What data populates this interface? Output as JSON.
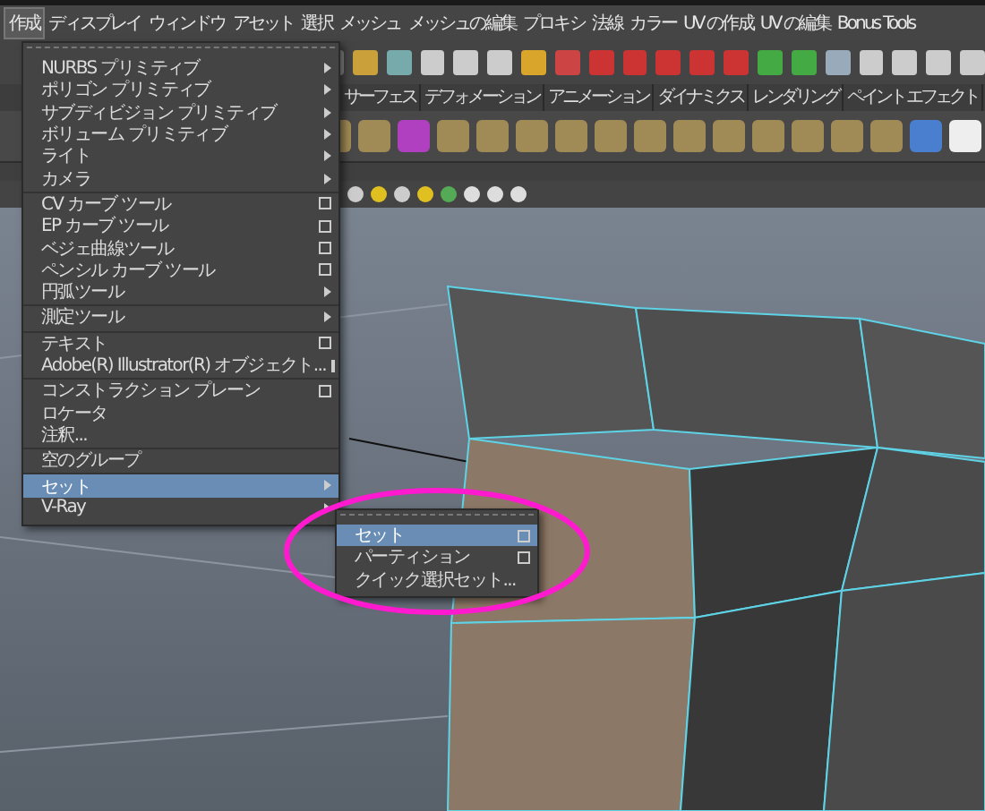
{
  "menubar": [
    {
      "label": "作成",
      "selected": true
    },
    {
      "label": "ディスプレイ",
      "selected": false
    },
    {
      "label": "ウィンドウ",
      "selected": false
    },
    {
      "label": "アセット",
      "selected": false
    },
    {
      "label": "選択",
      "selected": false
    },
    {
      "label": "メッシュ",
      "selected": false
    },
    {
      "label": "メッシュの編集",
      "selected": false
    },
    {
      "label": "プロキシ",
      "selected": false
    },
    {
      "label": "法線",
      "selected": false
    },
    {
      "label": "カラー",
      "selected": false
    },
    {
      "label": "UV の作成",
      "selected": false
    },
    {
      "label": "UV の編集",
      "selected": false
    },
    {
      "label": "Bonus Tools",
      "selected": false
    }
  ],
  "shelf_tabs": [
    {
      "label": "サーフェス"
    },
    {
      "label": "デフォメーション"
    },
    {
      "label": "アニメーション"
    },
    {
      "label": "ダイナミクス"
    },
    {
      "label": "レンダリング"
    },
    {
      "label": "ペイント エフェクト"
    }
  ],
  "create_menu": {
    "items": [
      {
        "label": "NURBS プリミティブ",
        "kind": "submenu",
        "divider_above": false,
        "selected": false
      },
      {
        "label": "ポリゴン プリミティブ",
        "kind": "submenu",
        "divider_above": false,
        "selected": false
      },
      {
        "label": "サブディビジョン プリミティブ",
        "kind": "submenu",
        "divider_above": false,
        "selected": false
      },
      {
        "label": "ボリューム プリミティブ",
        "kind": "submenu",
        "divider_above": false,
        "selected": false
      },
      {
        "label": "ライト",
        "kind": "submenu",
        "divider_above": false,
        "selected": false
      },
      {
        "label": "カメラ",
        "kind": "submenu",
        "divider_above": false,
        "selected": false
      },
      {
        "label": "CV カーブ ツール",
        "kind": "option",
        "divider_above": true,
        "selected": false
      },
      {
        "label": "EP カーブ ツール",
        "kind": "option",
        "divider_above": false,
        "selected": false
      },
      {
        "label": "ベジェ曲線ツール",
        "kind": "option",
        "divider_above": false,
        "selected": false
      },
      {
        "label": "ペンシル カーブ ツール",
        "kind": "option",
        "divider_above": false,
        "selected": false
      },
      {
        "label": "円弧ツール",
        "kind": "submenu",
        "divider_above": false,
        "selected": false
      },
      {
        "label": "測定ツール",
        "kind": "submenu",
        "divider_above": true,
        "selected": false
      },
      {
        "label": "テキスト",
        "kind": "option",
        "divider_above": true,
        "selected": false
      },
      {
        "label": "Adobe(R) Illustrator(R) オブジェクト...",
        "kind": "option",
        "divider_above": false,
        "selected": false
      },
      {
        "label": "コンストラクション プレーン",
        "kind": "option",
        "divider_above": true,
        "selected": false
      },
      {
        "label": "ロケータ",
        "kind": "plain",
        "divider_above": false,
        "selected": false
      },
      {
        "label": "注釈...",
        "kind": "plain",
        "divider_above": false,
        "selected": false
      },
      {
        "label": "空のグループ",
        "kind": "plain",
        "divider_above": true,
        "selected": false
      },
      {
        "label": "セット",
        "kind": "submenu",
        "divider_above": true,
        "selected": true
      },
      {
        "label": "V-Ray",
        "kind": "submenu",
        "divider_above": false,
        "selected": false
      }
    ]
  },
  "set_submenu": {
    "items": [
      {
        "label": "セット",
        "kind": "option",
        "selected": true
      },
      {
        "label": "パーティション",
        "kind": "option",
        "selected": false
      },
      {
        "label": "クイック選択セット...",
        "kind": "plain",
        "selected": false
      }
    ]
  }
}
